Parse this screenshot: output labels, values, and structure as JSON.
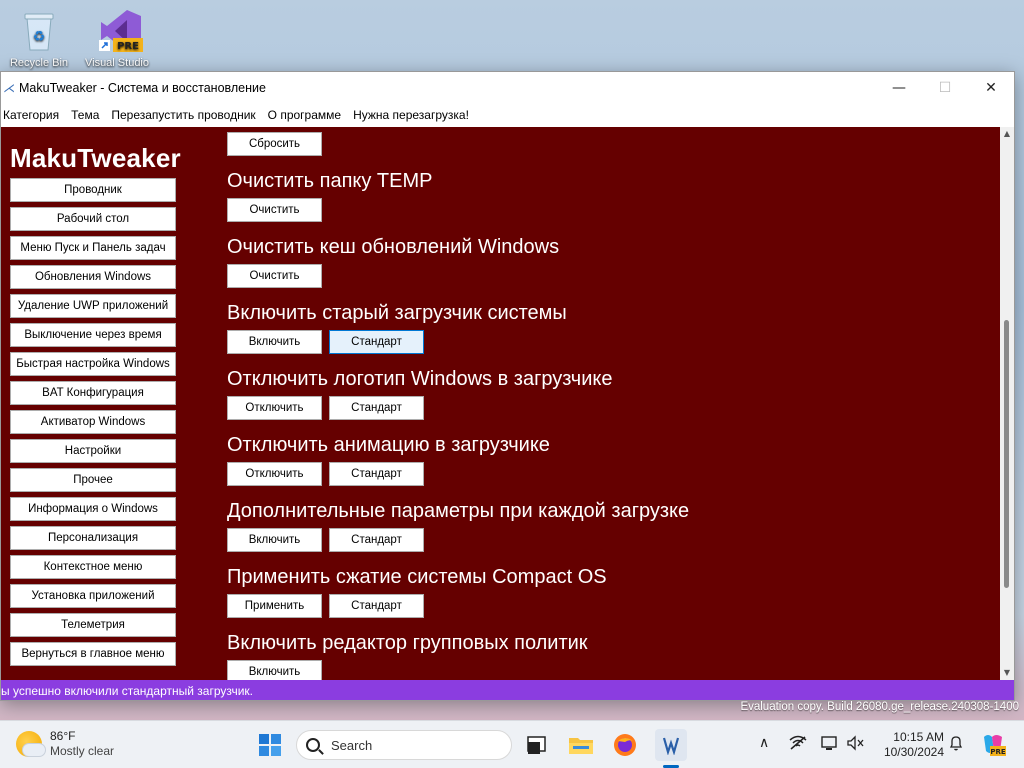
{
  "desktop": {
    "icons": [
      {
        "label": "Recycle Bin"
      },
      {
        "label": "Visual Studio",
        "badge": "PRE"
      }
    ],
    "evaluation_text": "Evaluation copy. Build 26080.ge_release.240308-1400"
  },
  "window": {
    "title": "MakuTweaker - Система и восстановление",
    "controls": {
      "minimize": "—",
      "maximize": "☐",
      "close": "✕"
    }
  },
  "menu": [
    "Категория",
    "Тема",
    "Перезапустить проводник",
    "О программе",
    "Нужна перезагрузка!"
  ],
  "sidebar": {
    "logo": "MakuTweaker",
    "items": [
      "Проводник",
      "Рабочий стол",
      "Меню Пуск и Панель задач",
      "Обновления Windows",
      "Удаление UWP приложений",
      "Выключение через время",
      "Быстрая настройка Windows",
      "BAT Конфигурация",
      "Активатор Windows",
      "Настройки",
      "Прочее",
      "Информация о Windows",
      "Персонализация",
      "Контекстное меню",
      "Установка приложений",
      "Телеметрия",
      "Вернуться в главное меню"
    ]
  },
  "main": {
    "top_button": "Сбросить",
    "sections": [
      {
        "title": "Очистить папку TEMP",
        "buttons": [
          "Очистить"
        ]
      },
      {
        "title": "Очистить кеш обновлений Windows",
        "buttons": [
          "Очистить"
        ]
      },
      {
        "title": "Включить старый загрузчик системы",
        "buttons": [
          "Включить",
          "Стандарт"
        ]
      },
      {
        "title": "Отключить логотип Windows в загрузчике",
        "buttons": [
          "Отключить",
          "Стандарт"
        ]
      },
      {
        "title": "Отключить анимацию в загрузчике",
        "buttons": [
          "Отключить",
          "Стандарт"
        ]
      },
      {
        "title": "Дополнительные параметры при каждой загрузке",
        "buttons": [
          "Включить",
          "Стандарт"
        ]
      },
      {
        "title": "Применить сжатие системы Compact OS",
        "buttons": [
          "Применить",
          "Стандарт"
        ]
      },
      {
        "title": "Включить редактор групповых политик",
        "buttons": [
          "Включить"
        ]
      }
    ]
  },
  "status": "ы успешно включили стандартный загрузчик.",
  "colors": {
    "content_bg": "#650000",
    "status_bg": "#8b3de0",
    "accent": "#0078d4"
  },
  "taskbar": {
    "weather_temp": "86°F",
    "weather_condition": "Mostly clear",
    "search_placeholder": "Search",
    "time": "10:15 AM",
    "date": "10/30/2024",
    "pinned": [
      "start-icon",
      "search",
      "task-view-icon",
      "file-explorer-icon",
      "firefox-icon",
      "makutweaker-icon"
    ]
  }
}
